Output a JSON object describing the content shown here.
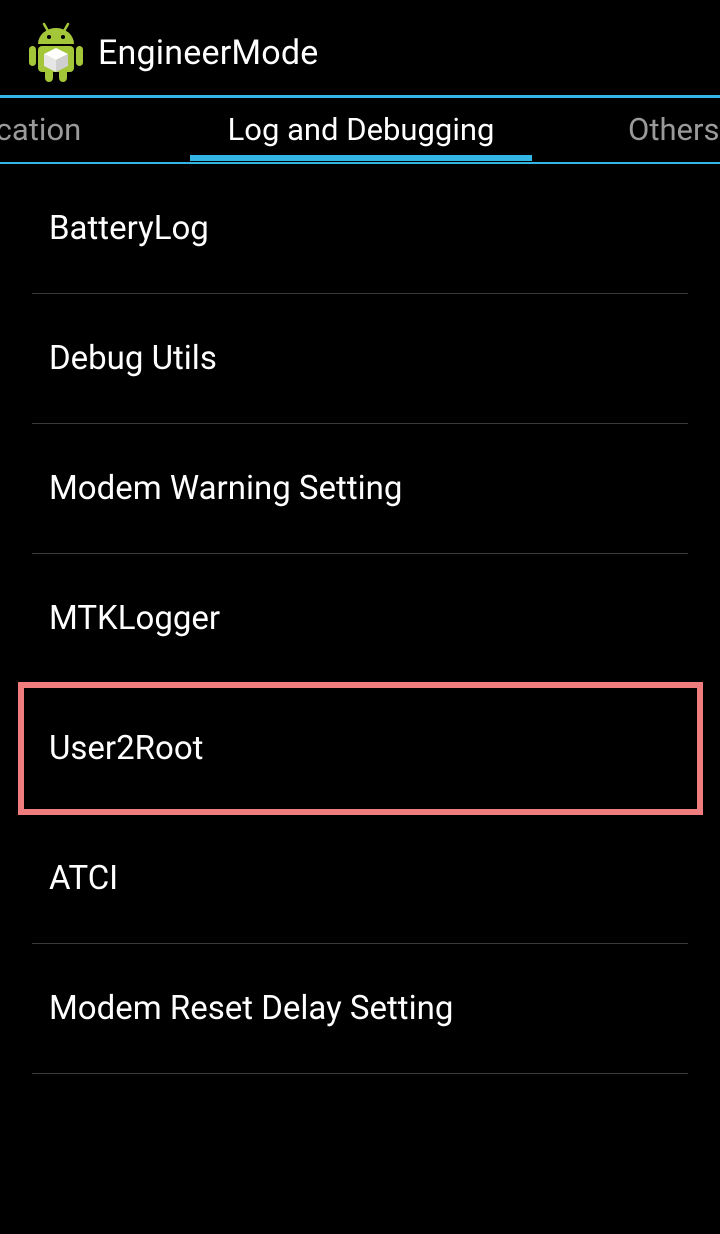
{
  "app": {
    "title": "EngineerMode",
    "icon": "android-robot-icon",
    "accent_color": "#33b5e5"
  },
  "tabs": [
    {
      "label": "Location",
      "visible_text": "ocation",
      "active": false
    },
    {
      "label": "Log and Debugging",
      "visible_text": "Log and Debugging",
      "active": true
    },
    {
      "label": "Others",
      "visible_text": "Others",
      "active": false
    }
  ],
  "list": {
    "items": [
      {
        "label": "BatteryLog"
      },
      {
        "label": "Debug Utils"
      },
      {
        "label": "Modem Warning Setting"
      },
      {
        "label": "MTKLogger"
      },
      {
        "label": "User2Root",
        "highlighted": true
      },
      {
        "label": "ATCI"
      },
      {
        "label": "Modem Reset Delay Setting"
      }
    ]
  },
  "highlight": {
    "target": "User2Root",
    "color": "#ef7d7d"
  }
}
